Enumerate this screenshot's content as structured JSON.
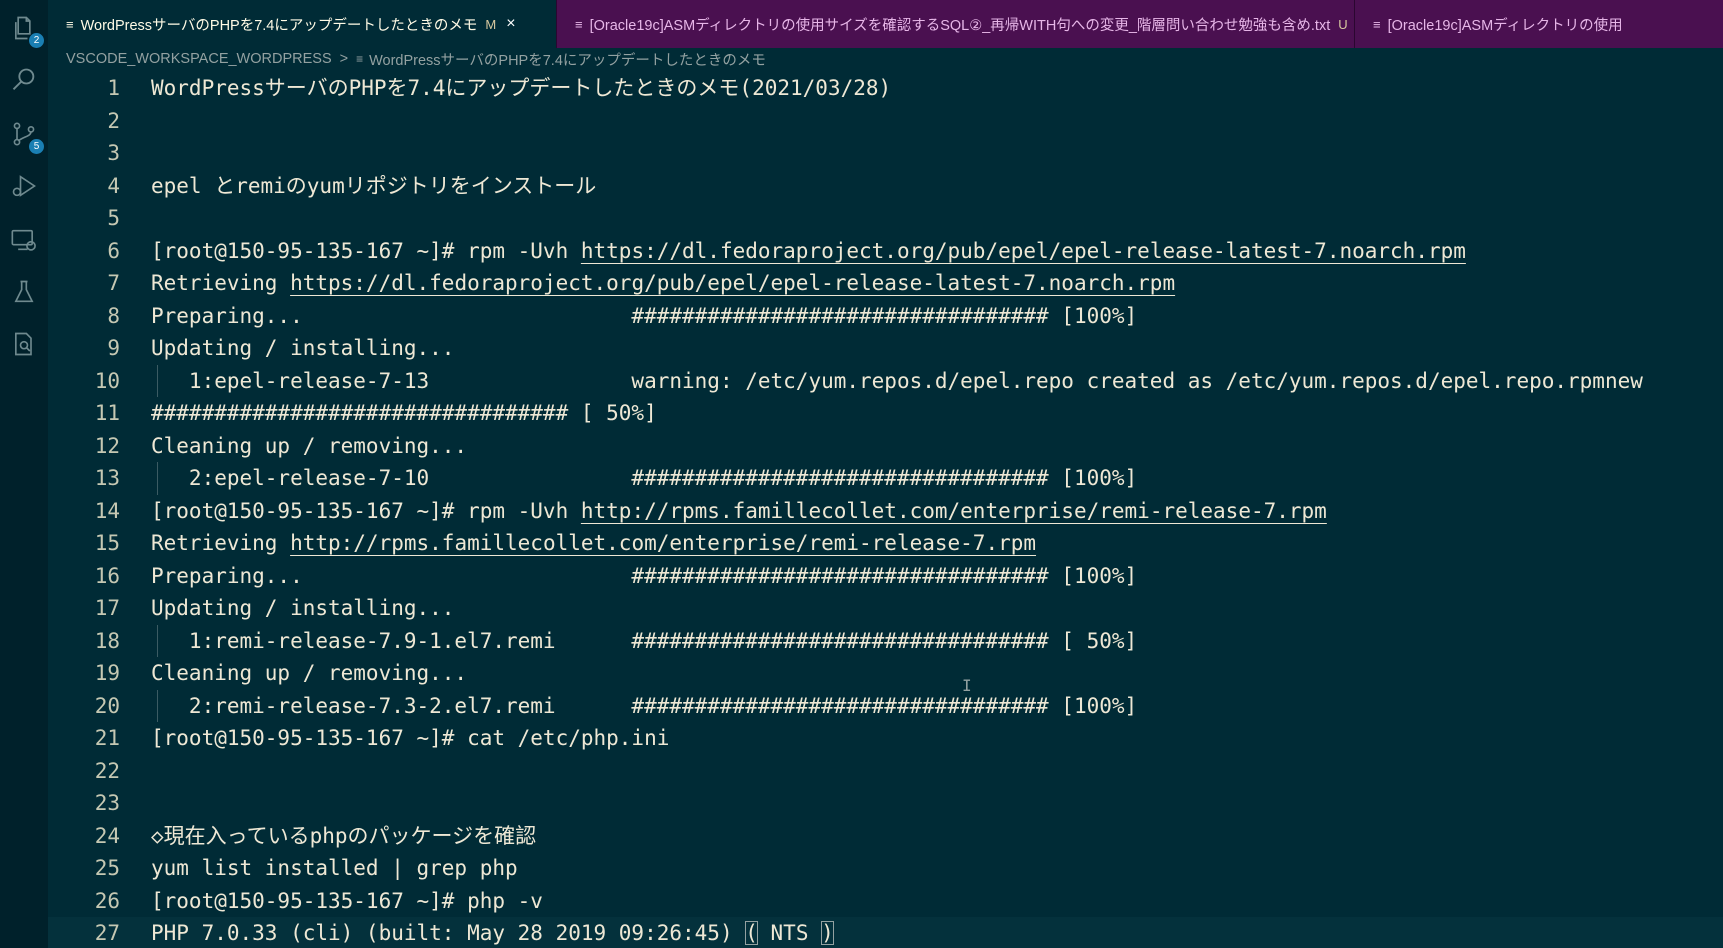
{
  "activity_bar": {
    "items": [
      {
        "name": "explorer-icon",
        "badge": "2"
      },
      {
        "name": "search-icon",
        "badge": ""
      },
      {
        "name": "source-control-icon",
        "badge": "5"
      },
      {
        "name": "run-debug-icon",
        "badge": ""
      },
      {
        "name": "remote-explorer-icon",
        "badge": ""
      },
      {
        "name": "testing-icon",
        "badge": ""
      },
      {
        "name": "document-search-icon",
        "badge": ""
      }
    ]
  },
  "tabs": [
    {
      "label": "WordPressサーバのPHPを7.4にアップデートしたときのメモ",
      "status": "M",
      "active": true
    },
    {
      "label": "[Oracle19c]ASMディレクトリの使用サイズを確認するSQL②_再帰WITH句への変更_階層問い合わせ勉強も含め.txt",
      "status": "U",
      "active": false
    },
    {
      "label": "[Oracle19c]ASMディレクトリの使用",
      "status": "",
      "active": false
    }
  ],
  "breadcrumb": {
    "workspace": "VSCODE_WORKSPACE_WORDPRESS",
    "separator": ">",
    "file": "WordPressサーバのPHPを7.4にアップデートしたときのメモ"
  },
  "editor": {
    "lines": [
      {
        "n": "1",
        "segments": [
          {
            "t": "WordPressサーバのPHPを7.4にアップデートしたときのメモ(2021/03/28)"
          }
        ]
      },
      {
        "n": "2",
        "segments": []
      },
      {
        "n": "3",
        "segments": []
      },
      {
        "n": "4",
        "segments": [
          {
            "t": "epel とremiのyumリポジトリをインストール"
          }
        ]
      },
      {
        "n": "5",
        "segments": []
      },
      {
        "n": "6",
        "segments": [
          {
            "t": "[root@150-95-135-167 ~]# rpm -Uvh "
          },
          {
            "t": "https://dl.fedoraproject.org/pub/epel/epel-release-latest-7.noarch.rpm",
            "u": true
          }
        ]
      },
      {
        "n": "7",
        "segments": [
          {
            "t": "Retrieving "
          },
          {
            "t": "https://dl.fedoraproject.org/pub/epel/epel-release-latest-7.noarch.rpm",
            "u": true
          }
        ]
      },
      {
        "n": "8",
        "segments": [
          {
            "t": "Preparing...                          ################################# [100%]"
          }
        ]
      },
      {
        "n": "9",
        "segments": [
          {
            "t": "Updating / installing..."
          }
        ]
      },
      {
        "n": "10",
        "guide": true,
        "segments": [
          {
            "t": "   1:epel-release-7-13                warning: /etc/yum.repos.d/epel.repo created as /etc/yum.repos.d/epel.repo.rpmnew"
          }
        ]
      },
      {
        "n": "11",
        "segments": [
          {
            "t": "################################# [ 50%]"
          }
        ]
      },
      {
        "n": "12",
        "segments": [
          {
            "t": "Cleaning up / removing..."
          }
        ]
      },
      {
        "n": "13",
        "guide": true,
        "segments": [
          {
            "t": "   2:epel-release-7-10                ################################# [100%]"
          }
        ]
      },
      {
        "n": "14",
        "segments": [
          {
            "t": "[root@150-95-135-167 ~]# rpm -Uvh "
          },
          {
            "t": "http://rpms.famillecollet.com/enterprise/remi-release-7.rpm",
            "u": true
          }
        ]
      },
      {
        "n": "15",
        "segments": [
          {
            "t": "Retrieving "
          },
          {
            "t": "http://rpms.famillecollet.com/enterprise/remi-release-7.rpm",
            "u": true
          }
        ]
      },
      {
        "n": "16",
        "segments": [
          {
            "t": "Preparing...                          ################################# [100%]"
          }
        ]
      },
      {
        "n": "17",
        "segments": [
          {
            "t": "Updating / installing..."
          }
        ]
      },
      {
        "n": "18",
        "guide": true,
        "segments": [
          {
            "t": "   1:remi-release-7.9-1.el7.remi      ################################# [ 50%]"
          }
        ]
      },
      {
        "n": "19",
        "segments": [
          {
            "t": "Cleaning up / removing..."
          }
        ]
      },
      {
        "n": "20",
        "guide": true,
        "segments": [
          {
            "t": "   2:remi-release-7.3-2.el7.remi      ################################# [100%]"
          }
        ]
      },
      {
        "n": "21",
        "segments": [
          {
            "t": "[root@150-95-135-167 ~]# cat /etc/php.ini"
          }
        ]
      },
      {
        "n": "22",
        "segments": []
      },
      {
        "n": "23",
        "segments": []
      },
      {
        "n": "24",
        "segments": [
          {
            "t": "◇現在入っているphpのパッケージを確認"
          }
        ]
      },
      {
        "n": "25",
        "segments": [
          {
            "t": "yum list installed | grep php"
          }
        ]
      },
      {
        "n": "26",
        "segments": [
          {
            "t": "[root@150-95-135-167 ~]# php -v"
          }
        ]
      },
      {
        "n": "27",
        "current": true,
        "segments": [
          {
            "t": "PHP 7.0.33 (cli) (built: May 28 2019 09:26:45) "
          },
          {
            "t": "(",
            "box": true
          },
          {
            "t": " NTS "
          },
          {
            "t": ")",
            "box": true
          }
        ]
      }
    ]
  },
  "colors": {
    "editor_bg": "#002b36",
    "tab_bar_bg": "#4a1050",
    "text": "#eee8d5",
    "line_number": "#c5c8b3",
    "badge": "#1a7fb3"
  }
}
